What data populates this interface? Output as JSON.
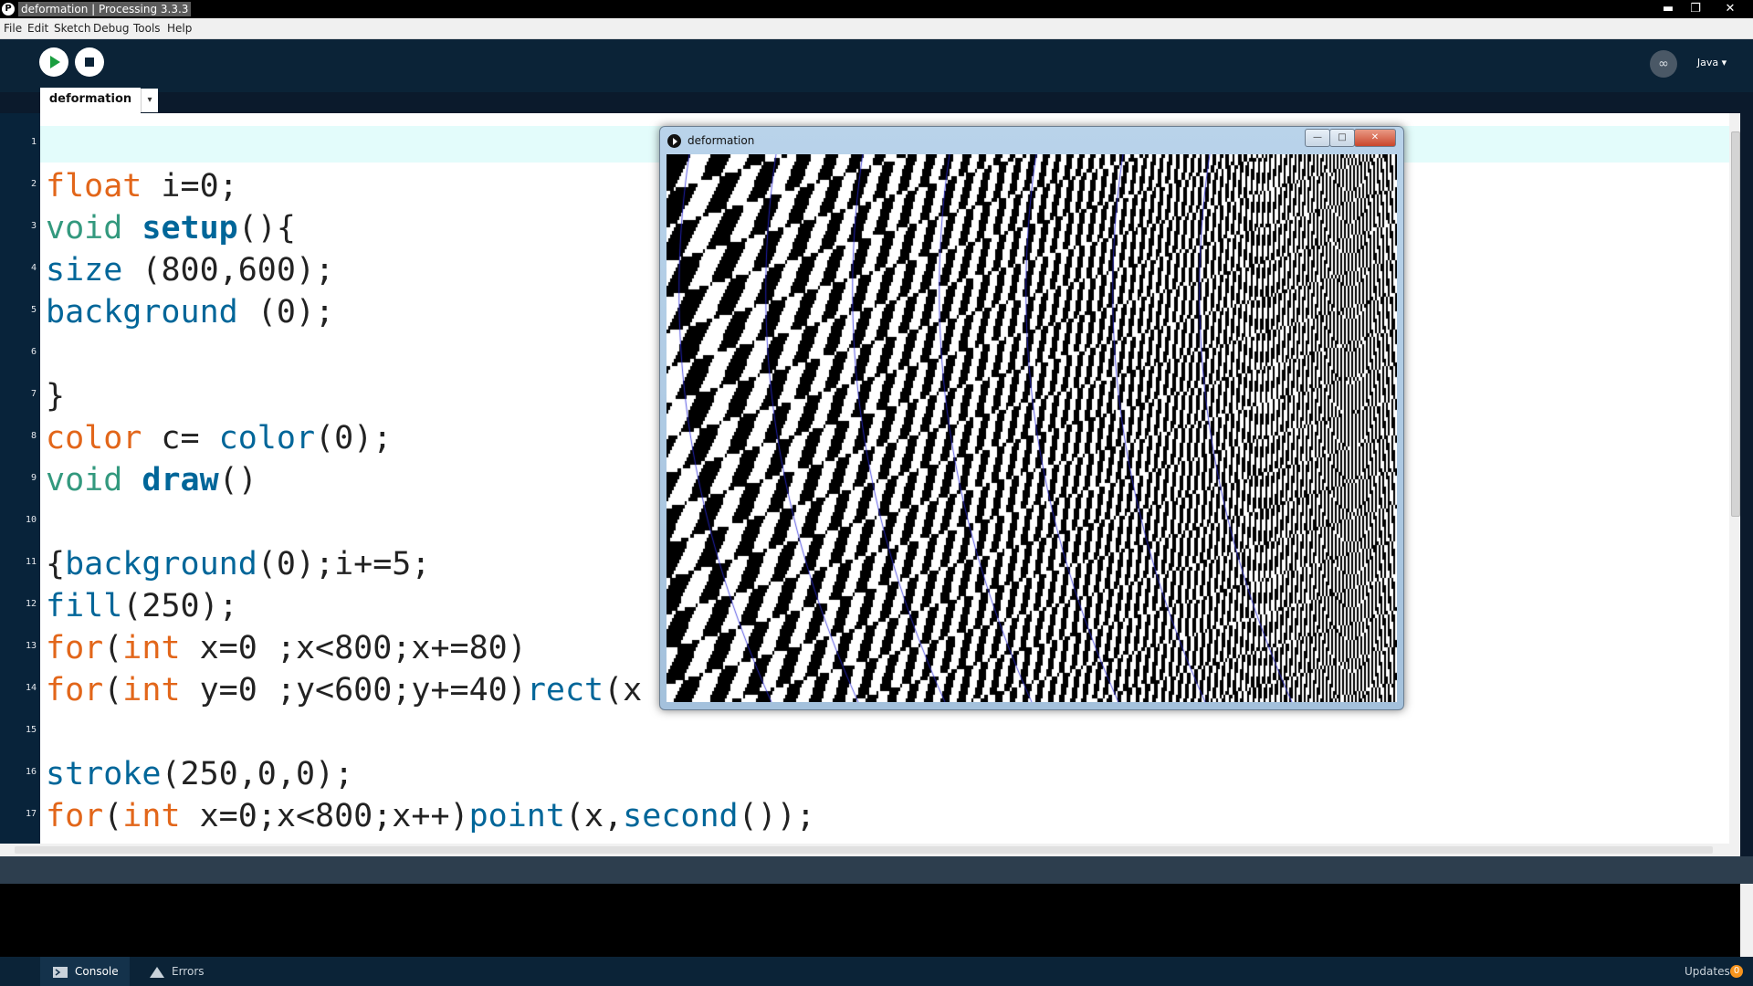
{
  "window": {
    "title": "deformation | Processing 3.3.3",
    "app_icon_glyph": "P",
    "minimize_glyph": "▬",
    "restore_glyph": "❐",
    "close_glyph": "✕"
  },
  "menu": [
    "File",
    "Edit",
    "Sketch",
    "Debug",
    "Tools",
    "Help"
  ],
  "toolbar": {
    "run_icon": "play-icon",
    "stop_icon": "stop-icon",
    "mode_icon_glyph": "∞",
    "mode_label": "Java ▾"
  },
  "tabs": {
    "active": "deformation",
    "menu_glyph": "▾"
  },
  "editor": {
    "line_numbers": [
      "1",
      "2",
      "3",
      "4",
      "5",
      "6",
      "7",
      "8",
      "9",
      "10",
      "11",
      "12",
      "13",
      "14",
      "15",
      "16",
      "17"
    ],
    "code": [
      "",
      "float i=0;",
      "void setup(){",
      "size (800,600);",
      "background (0);",
      "",
      "}",
      "color c= color(0);",
      "void draw()",
      "",
      "{background(0);i+=5;",
      "fill(250);",
      "for(int x=0 ;x<800;x+=80)",
      "for(int y=0 ;y<600;y+=40)rect(x",
      "",
      "stroke(250,0,0);",
      "for(int x=0;x<800;x++)point(x,second());"
    ]
  },
  "sketch_window": {
    "title": "deformation",
    "minimize_glyph": "—",
    "maximize_glyph": "□",
    "close_glyph": "✕"
  },
  "console": {
    "console_tab": "Console",
    "errors_tab": "Errors",
    "updates_label": "Updates",
    "updates_count": "0"
  },
  "colors": {
    "keyword": "#e2661a",
    "function": "#006699",
    "type": "#33997e",
    "toolbar_bg": "#0b2337"
  }
}
